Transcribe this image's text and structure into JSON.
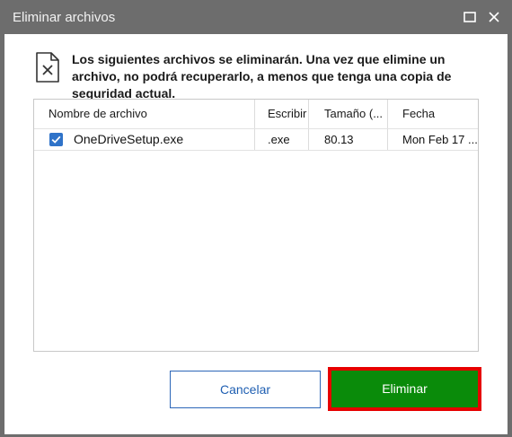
{
  "window": {
    "title": "Eliminar archivos"
  },
  "message": "Los siguientes archivos se eliminarán. Una vez que elimine un archivo, no podrá recuperarlo, a menos que tenga una copia de seguridad actual.",
  "table": {
    "columns": [
      "Nombre de archivo",
      "Escribir",
      "Tamaño (...",
      "Fecha"
    ],
    "rows": [
      {
        "checked": true,
        "name": "OneDriveSetup.exe",
        "type": ".exe",
        "size": "80.13",
        "date": "Mon Feb 17 ..."
      }
    ]
  },
  "buttons": {
    "cancel": "Cancelar",
    "delete": "Eliminar"
  },
  "colors": {
    "titlebar": "#6d6d6d",
    "accent_blue": "#2f73c9",
    "delete_green": "#0a8b0a",
    "highlight_red": "#e60000"
  },
  "icons": {
    "file_delete": "file-x-icon",
    "maximize": "maximize-icon",
    "close": "close-icon",
    "checkbox": "checkbox-checked-icon"
  }
}
